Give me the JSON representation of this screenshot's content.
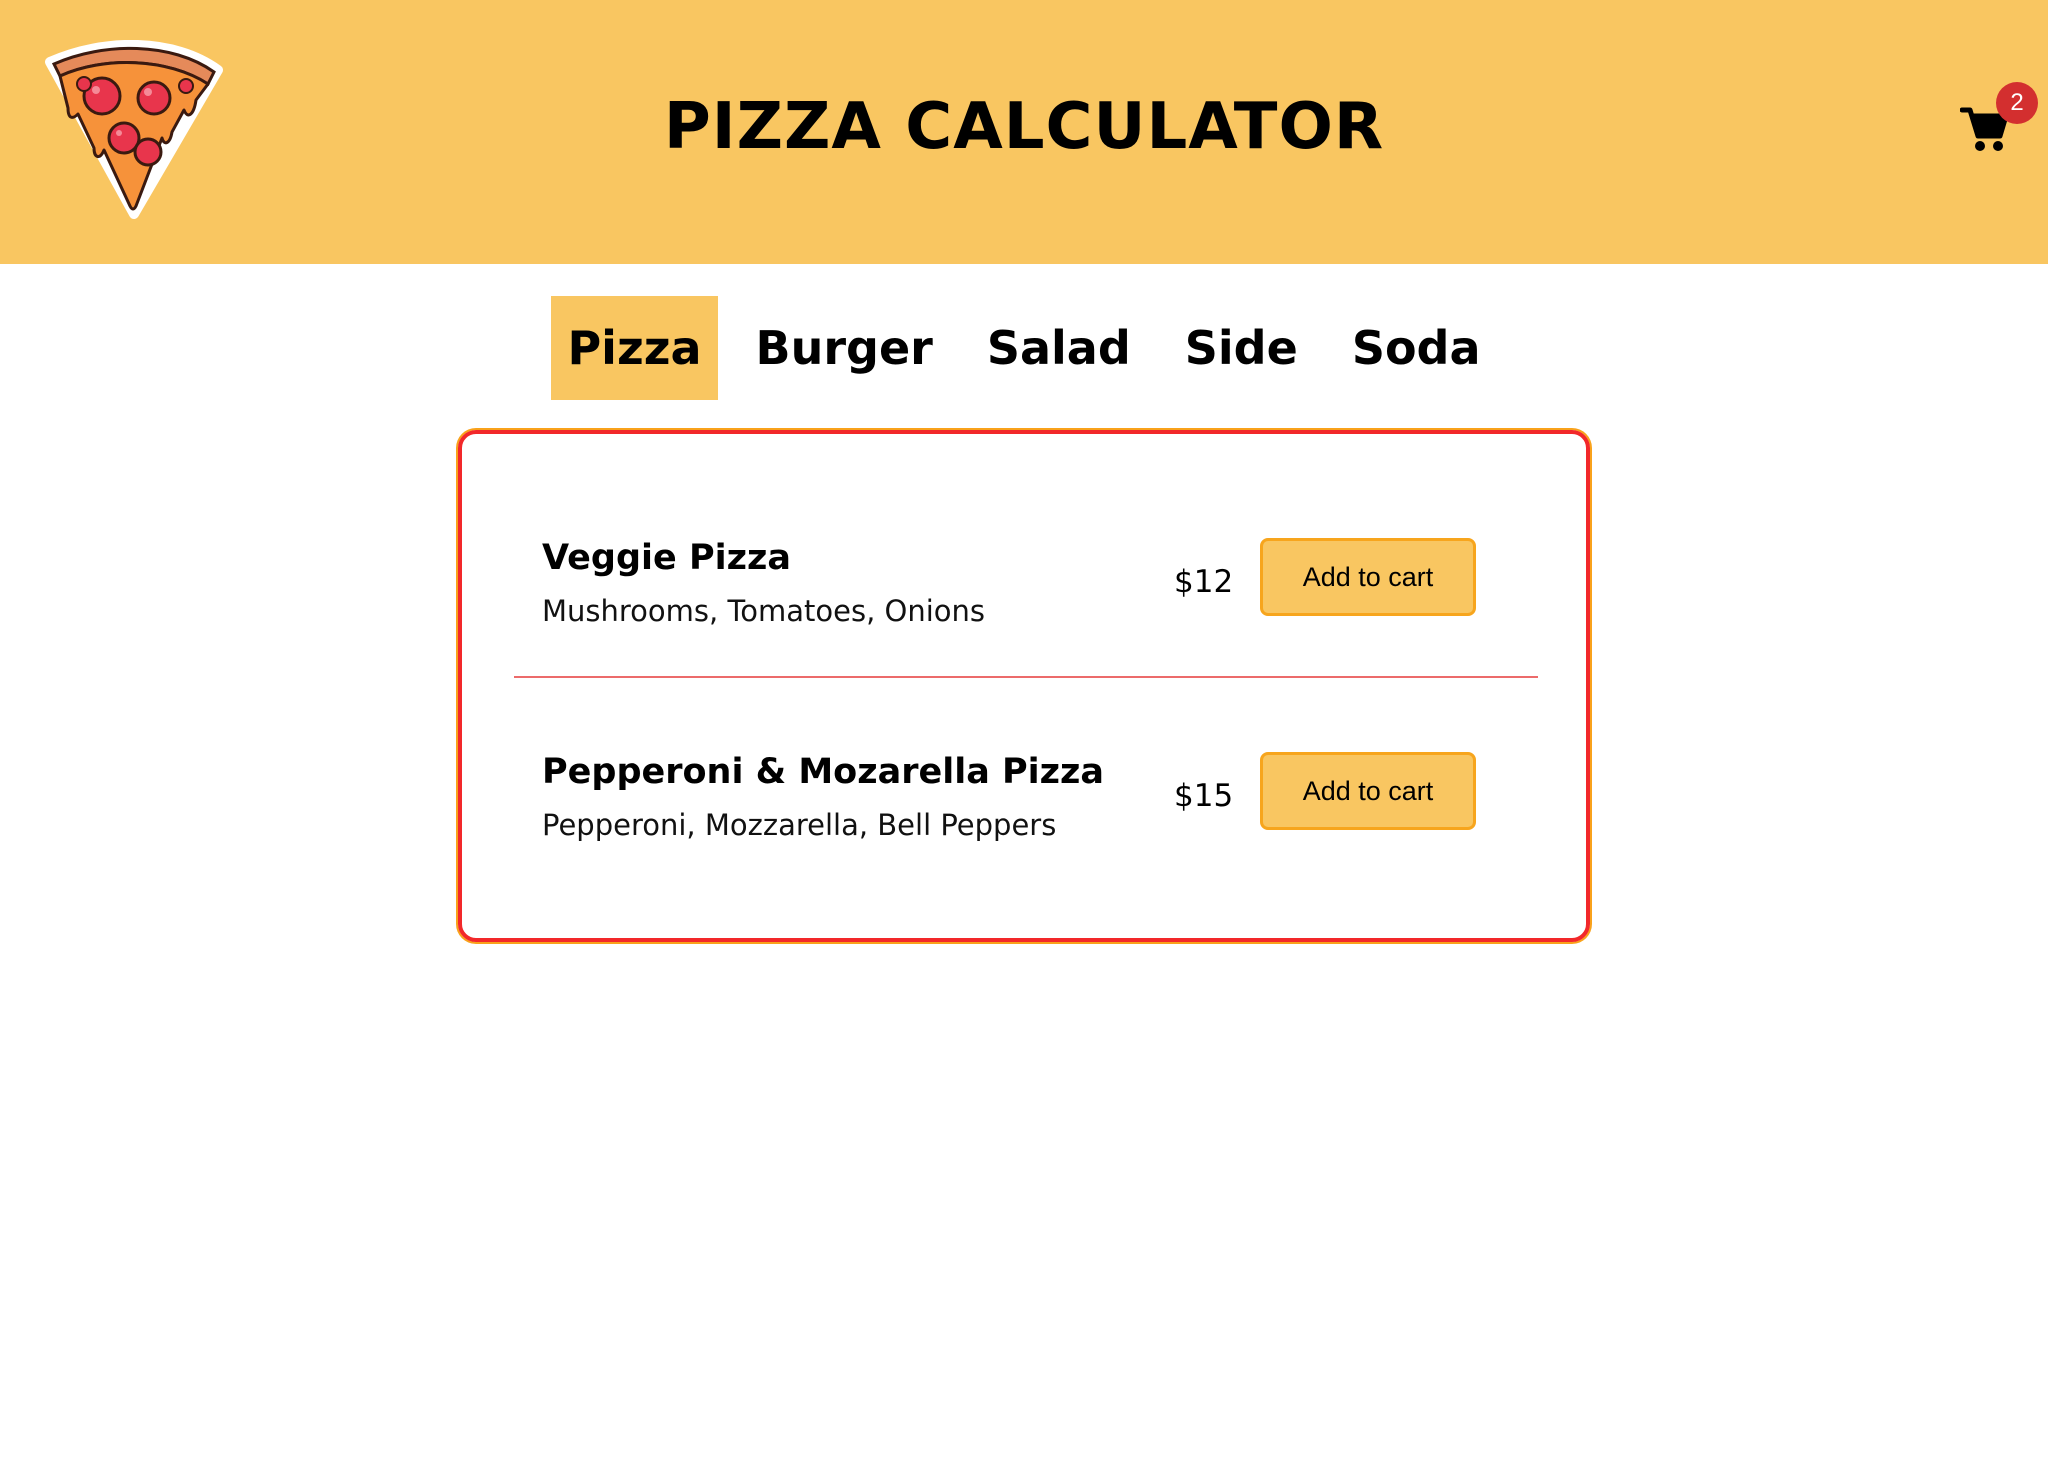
{
  "header": {
    "title": "PIZZA CALCULATOR",
    "logo_icon": "pizza-slice-icon",
    "cart_icon": "shopping-cart-icon",
    "cart_count": "2"
  },
  "tabs": [
    {
      "label": "Pizza",
      "active": true
    },
    {
      "label": "Burger",
      "active": false
    },
    {
      "label": "Salad",
      "active": false
    },
    {
      "label": "Side",
      "active": false
    },
    {
      "label": "Soda",
      "active": false
    }
  ],
  "menu": {
    "items": [
      {
        "name": "Veggie Pizza",
        "description": "Mushrooms, Tomatoes, Onions",
        "price": "$12",
        "button_label": "Add to cart"
      },
      {
        "name": "Pepperoni & Mozarella Pizza",
        "description": "Pepperoni, Mozzarella, Bell Peppers",
        "price": "$15",
        "button_label": "Add to cart"
      }
    ]
  },
  "colors": {
    "header_bg": "#f9c661",
    "card_border": "#f2282a",
    "button_border": "#f7a51d",
    "badge": "#d32f2f"
  }
}
